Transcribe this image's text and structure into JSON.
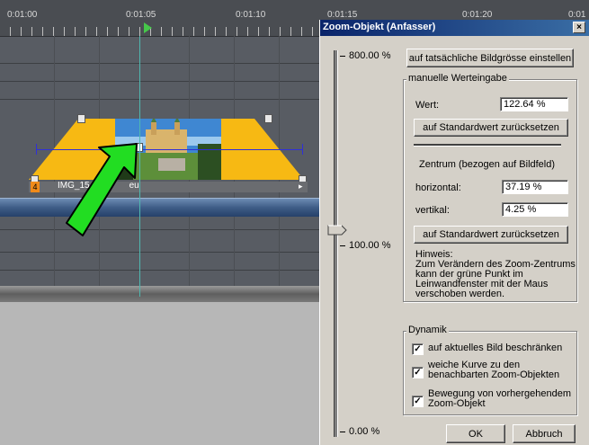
{
  "timeline": {
    "timecodes": [
      "0:01:00",
      "0:01:05",
      "0:01:10",
      "0:01:15",
      "0:01:20",
      "0:01"
    ],
    "clip_number": "4",
    "clip_label": "IMG_15",
    "clip_label_tail": "eu"
  },
  "dialog": {
    "title": "Zoom-Objekt (Anfasser)",
    "close_label": "×",
    "scale_top": "800.00 %",
    "scale_mid": "100.00 %",
    "scale_bottom": "0.00 %",
    "actual_size_button": "auf tatsächliche Bildgrösse einstellen",
    "manual": {
      "group_title": "manuelle Werteingabe",
      "value_label": "Wert:",
      "value": "122.64 %",
      "reset_button": "auf Standardwert zurücksetzen"
    },
    "center": {
      "heading": "Zentrum (bezogen auf Bildfeld)",
      "horizontal_label": "horizontal:",
      "horizontal_value": "37.19 %",
      "vertical_label": "vertikal:",
      "vertical_value": "4.25 %",
      "reset_button": "auf Standardwert zurücksetzen"
    },
    "hint": {
      "title": "Hinweis:",
      "line1": "Zum Verändern des Zoom-Zentrums",
      "line2": "kann der grüne Punkt  im",
      "line3": "Leinwandfenster mit der Maus",
      "line4": "verschoben werden."
    },
    "dynamics": {
      "group_title": "Dynamik",
      "opt1": "auf aktuelles Bild beschränken",
      "opt2_line1": "weiche Kurve zu den",
      "opt2_line2": "benachbarten Zoom-Objekten",
      "opt3_line1": "Bewegung von vorhergehendem",
      "opt3_line2": "Zoom-Objekt",
      "check_mark": "✓"
    },
    "ok_button": "OK",
    "cancel_button": "Abbruch"
  },
  "colors": {
    "titlebar": "#0a246a",
    "zoom_trapezoid": "#f7b913",
    "arrow": "#22dd22",
    "dialog_bg": "#d4d0c8"
  }
}
